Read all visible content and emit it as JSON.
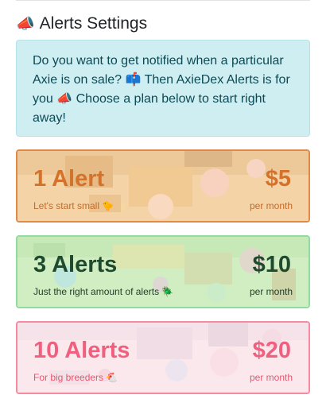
{
  "header": {
    "title": "Alerts Settings",
    "icon": "megaphone-icon",
    "icon_glyph": "📣"
  },
  "info": {
    "text": "Do you want to get notified when a particular Axie is on sale? 📫 Then AxieDex Alerts is for you 📣 Choose a plan below to start right away!"
  },
  "plans": [
    {
      "label": "1 Alert",
      "price": "$5",
      "subtitle": "Let's start small 🐤",
      "period": "per month"
    },
    {
      "label": "3 Alerts",
      "price": "$10",
      "subtitle": "Just the right amount of alerts 🪲",
      "period": "per month"
    },
    {
      "label": "10 Alerts",
      "price": "$20",
      "subtitle": "For big breeders 🐔",
      "period": "per month"
    }
  ],
  "colors": {
    "plan1_accent": "#d4722c",
    "plan2_accent": "#1f4a2e",
    "plan3_accent": "#f0607e",
    "info_bg": "#cfeef2"
  }
}
